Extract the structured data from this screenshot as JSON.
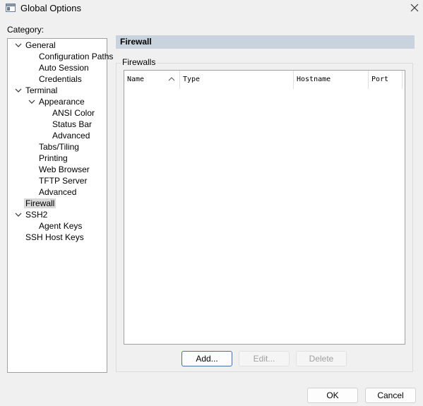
{
  "window": {
    "title": "Global Options",
    "icon": "app-window-icon",
    "close_icon": "close-icon"
  },
  "category_label": "Category:",
  "tree": {
    "general": "General",
    "configuration_paths": "Configuration Paths",
    "auto_session": "Auto Session",
    "credentials": "Credentials",
    "terminal": "Terminal",
    "appearance": "Appearance",
    "ansi_color": "ANSI Color",
    "status_bar": "Status Bar",
    "appearance_advanced": "Advanced",
    "tabs_tiling": "Tabs/Tiling",
    "printing": "Printing",
    "web_browser": "Web Browser",
    "tftp_server": "TFTP Server",
    "terminal_advanced": "Advanced",
    "firewall": "Firewall",
    "ssh2": "SSH2",
    "agent_keys": "Agent Keys",
    "ssh_host_keys": "SSH Host Keys",
    "selected": "Firewall"
  },
  "panel": {
    "header": "Firewall",
    "group_label": "Firewalls",
    "columns": [
      "Name",
      "Type",
      "Hostname",
      "Port"
    ],
    "sort_column": "Name",
    "sort_direction": "ascending"
  },
  "buttons": {
    "add": "Add...",
    "edit": "Edit...",
    "delete": "Delete",
    "ok": "OK",
    "cancel": "Cancel"
  },
  "colors": {
    "panel_header_bg": "#c8d3de",
    "default_button_border": "#4a6ea0",
    "selected_item_bg": "#d9d9d9"
  }
}
